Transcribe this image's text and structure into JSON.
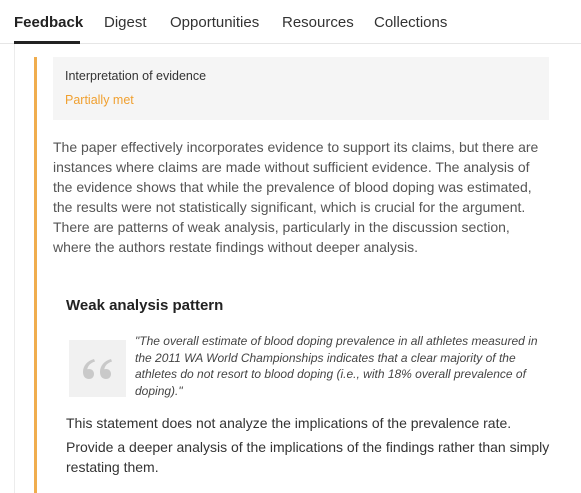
{
  "tabs": [
    {
      "label": "Feedback",
      "active": true
    },
    {
      "label": "Digest",
      "active": false
    },
    {
      "label": "Opportunities",
      "active": false
    },
    {
      "label": "Resources",
      "active": false
    },
    {
      "label": "Collections",
      "active": false
    }
  ],
  "criterion": {
    "title": "Interpretation of evidence",
    "status": "Partially met"
  },
  "feedback_paragraph": "The paper effectively incorporates evidence to support its claims, but there are instances where claims are made without sufficient evidence. The analysis of the evidence shows that while the prevalence of blood doping was estimated, the results were not statistically significant, which is crucial for the argument. There are patterns of weak analysis, particularly in the discussion section, where the authors restate findings without deeper analysis.",
  "pattern": {
    "title": "Weak analysis pattern",
    "quote": "\"The overall estimate of blood doping prevalence in all athletes measured in the 2011 WA World Championships indicates that a clear majority of the athletes do not resort to blood doping (i.e., with 18% overall prevalence of doping).\"",
    "analysis": "This statement does not analyze the implications of the prevalence rate.",
    "recommendation": "Provide a deeper analysis of the implications of the findings rather than simply restating them."
  },
  "colors": {
    "accent": "#f0ad4e",
    "status_partial": "#f0a030"
  }
}
